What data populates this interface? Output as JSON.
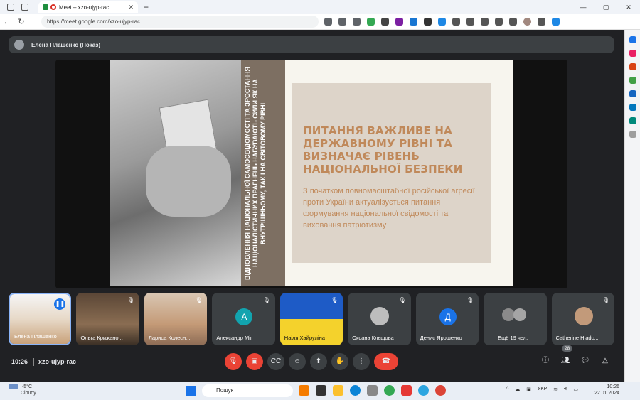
{
  "browser": {
    "tab_title": "Meet – xzo-ujyp-rac",
    "url": "https://meet.google.com/xzo-ujyp-rac"
  },
  "meet": {
    "presenter_label": "Елена Плашенко (Показ)",
    "slide": {
      "vertical_text": "ВІДНОВЛЕННЯ НАЦІОНАЛЬНОЇ САМОСВІДОМОСТІ ТА ЗРОСТАННЯ НАЦІОНАЛІСТИЧНИХ ПРАГНЕНЬ НАБУВАЮТЬ СИЛИ ЯК НА ВНУТРІШНЬОМУ, ТАК І НА СВІТОВОМУ РІВНІ",
      "heading": "ПИТАННЯ ВАЖЛИВЕ НА ДЕРЖАВНОМУ РІВНІ ТА ВИЗНАЧАЄ РІВЕНЬ НАЦІОНАЛЬНОЇ БЕЗПЕКИ",
      "body": "З початком повномасштабної російської агресії проти України актуалізується питання формування національної свідомості та виховання патріотизму"
    },
    "participants": [
      {
        "name": "Елена Плашенко",
        "type": "video",
        "speaking": true
      },
      {
        "name": "Ольга Крижано...",
        "type": "video",
        "muted": true
      },
      {
        "name": "Лариса Колесн...",
        "type": "video",
        "muted": true
      },
      {
        "name": "Александр Міг",
        "type": "letter",
        "letter": "А",
        "color": "#12a4af",
        "muted": true
      },
      {
        "name": "Наіля Хайруліна",
        "type": "video",
        "muted": true
      },
      {
        "name": "Оксана Клєщова",
        "type": "photo",
        "muted": true
      },
      {
        "name": "Денис Ярошенко",
        "type": "letter",
        "letter": "Д",
        "color": "#1a73e8",
        "muted": true
      },
      {
        "name": "Ещё 19 чел.",
        "type": "more"
      },
      {
        "name": "Catherine Hladc...",
        "type": "photo",
        "muted": true
      }
    ],
    "clock": "10:26",
    "meeting_code": "xzo-ujyp-rac",
    "participant_count": "28"
  },
  "taskbar": {
    "weather_temp": "-5°C",
    "weather_desc": "Cloudy",
    "search_placeholder": "Пошук",
    "language": "УКР",
    "time": "10:26",
    "date": "22.01.2024"
  },
  "colors": {
    "meet_bg": "#202124",
    "leave_red": "#ea4335",
    "slide_accent": "#c0895a",
    "slide_band": "#7d6f62"
  }
}
